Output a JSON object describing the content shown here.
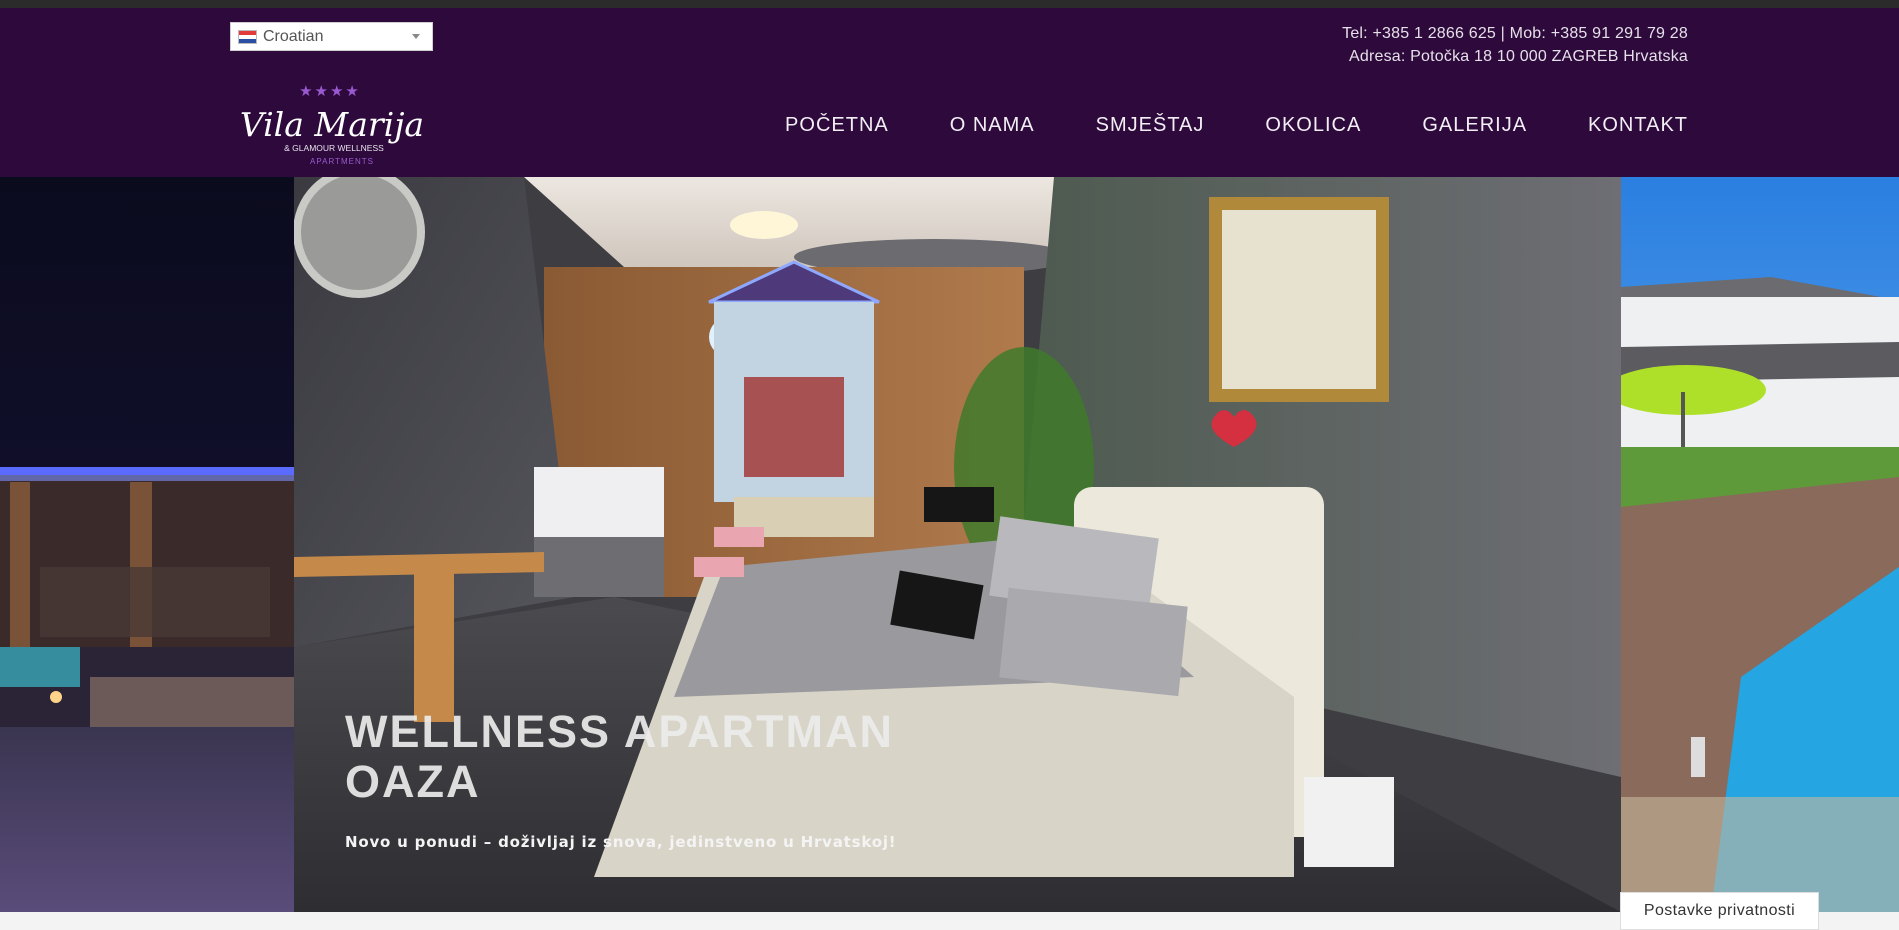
{
  "language": {
    "selected": "Croatian"
  },
  "contact": {
    "phones": "Tel: +385 1 2866 625 | Mob: +385 91 291 79 28",
    "address": "Adresa: Potočka 18 10 000 ZAGREB Hrvatska"
  },
  "logo": {
    "stars": "★★★★",
    "name": "Vila Marija",
    "line1": "& GLAMOUR WELLNESS",
    "line2": "APARTMENTS"
  },
  "nav": {
    "items": [
      "POČETNA",
      "O NAMA",
      "SMJEŠTAJ",
      "OKOLICA",
      "GALERIJA",
      "KONTAKT"
    ]
  },
  "slide": {
    "title": "WELLNESS APARTMAN OAZA",
    "subtitle": "Novo u ponudi – doživljaj iz snova, jedinstveno u Hrvatskoj!"
  },
  "privacy": {
    "label": "Postavke privatnosti"
  },
  "colors": {
    "header_bg": "#2d0a3b",
    "accent_purple": "#9b59d0"
  }
}
